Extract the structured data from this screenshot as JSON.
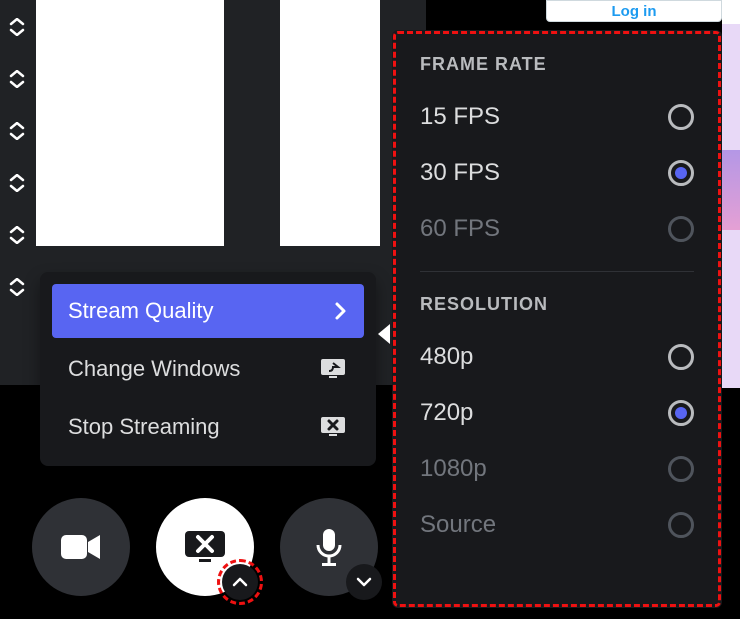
{
  "login_button": "Log in",
  "context_menu": {
    "items": [
      {
        "label": "Stream Quality",
        "icon": "chevron-right",
        "active": true
      },
      {
        "label": "Change Windows",
        "icon": "share-screen"
      },
      {
        "label": "Stop Streaming",
        "icon": "stop-screen"
      }
    ]
  },
  "submenu": {
    "frame_rate_header": "Frame Rate",
    "frame_rate_options": [
      {
        "label": "15 FPS",
        "selected": false,
        "enabled": true
      },
      {
        "label": "30 FPS",
        "selected": true,
        "enabled": true
      },
      {
        "label": "60 FPS",
        "selected": false,
        "enabled": false
      }
    ],
    "resolution_header": "Resolution",
    "resolution_options": [
      {
        "label": "480p",
        "selected": false,
        "enabled": true
      },
      {
        "label": "720p",
        "selected": true,
        "enabled": true
      },
      {
        "label": "1080p",
        "selected": false,
        "enabled": false
      },
      {
        "label": "Source",
        "selected": false,
        "enabled": false
      }
    ]
  },
  "call_controls": {
    "camera": "camera",
    "screen_share": "screen-share-active",
    "mic": "microphone"
  }
}
